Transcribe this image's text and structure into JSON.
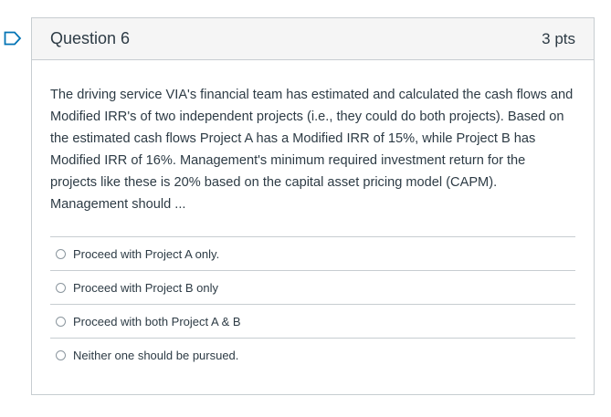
{
  "question": {
    "title": "Question 6",
    "points": "3 pts",
    "text": "The driving service VIA's financial team has estimated and calculated the cash flows and Modified IRR's of two independent projects (i.e., they could do both projects). Based on the estimated cash flows Project A has a Modified IRR of 15%, while Project B has Modified IRR of 16%.  Management's minimum required investment return for the projects like these is 20% based on the capital asset pricing model (CAPM). Management should ...",
    "answers": [
      {
        "label": "Proceed with Project A only."
      },
      {
        "label": "Proceed with Project B only"
      },
      {
        "label": "Proceed with both Project A & B"
      },
      {
        "label": "Neither one should be pursued."
      }
    ]
  },
  "colors": {
    "flag": "#0374b5",
    "border": "#c7cdd1",
    "header_bg": "#f5f5f5",
    "text": "#2d3b45"
  },
  "icons": {
    "flag": "flag-icon",
    "radio": "radio-unselected-icon"
  }
}
